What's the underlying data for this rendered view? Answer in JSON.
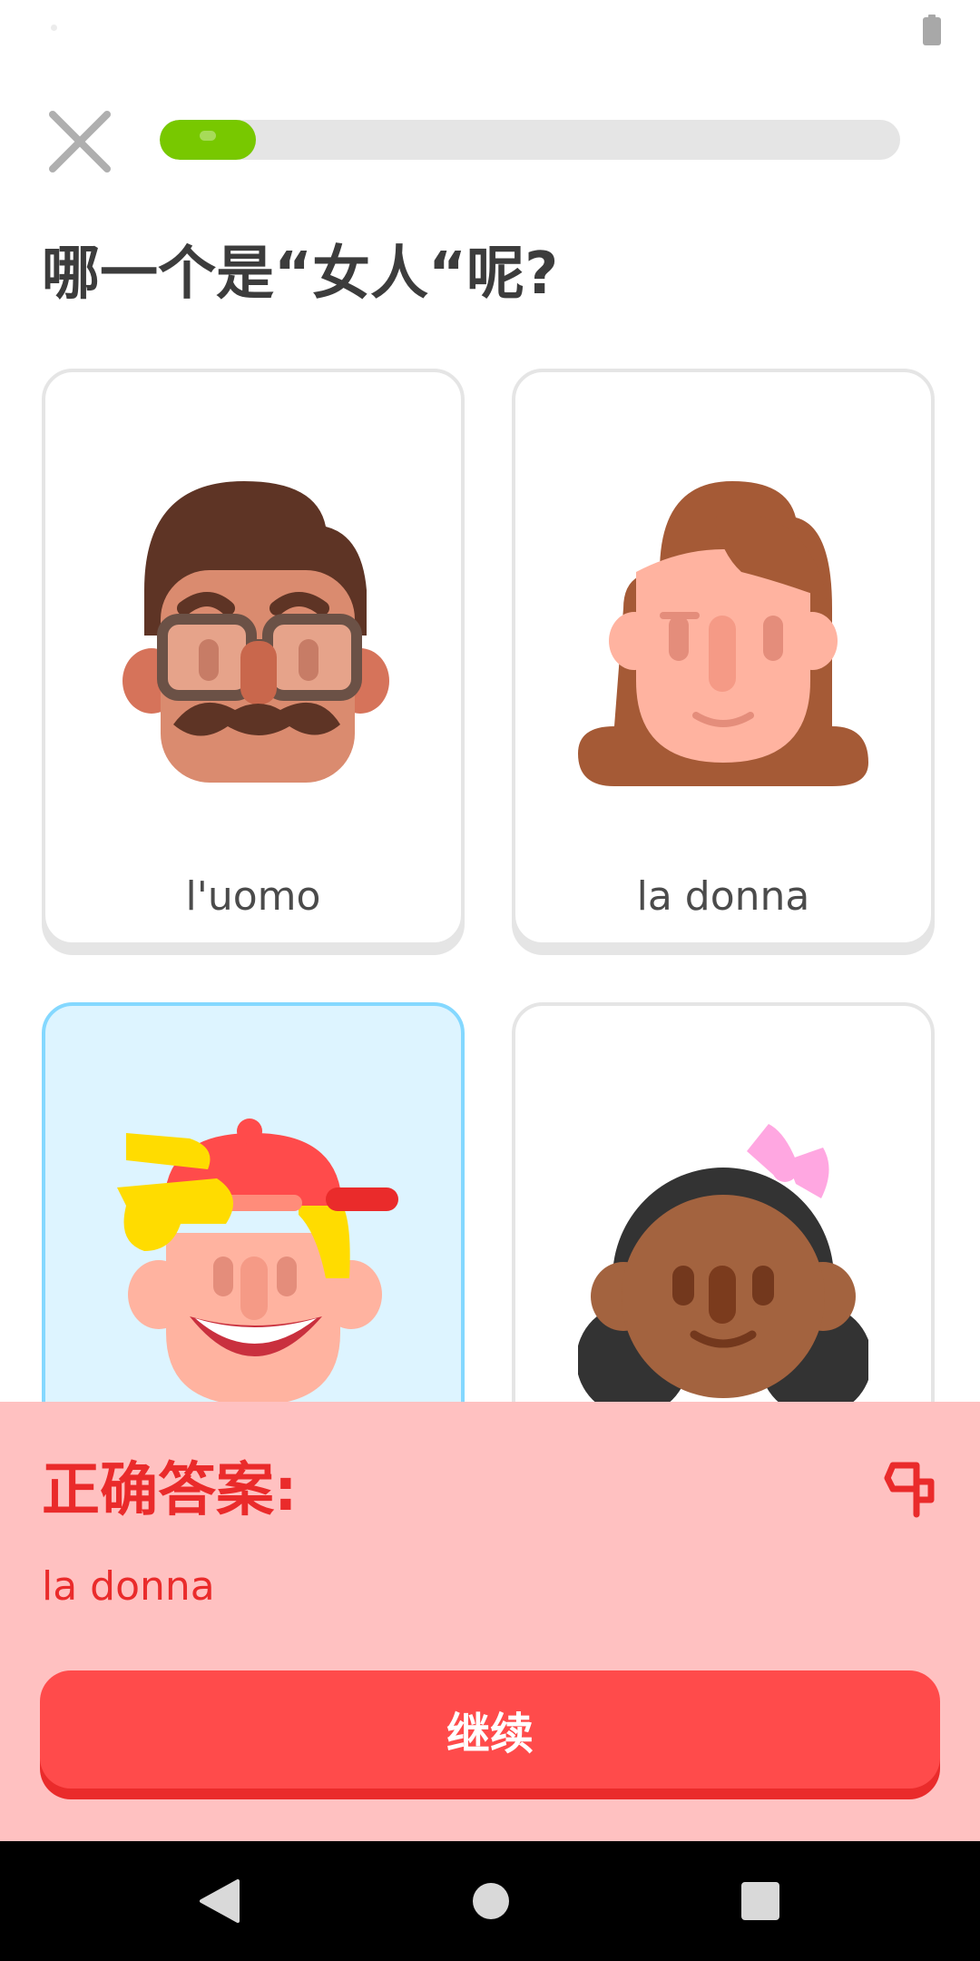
{
  "lesson": {
    "progress_fraction": 0.13,
    "progress_color": "#78c800",
    "question": "哪一个是“女人“呢?"
  },
  "options": [
    {
      "label": "l'uomo",
      "icon": "man-with-glasses-mustache-icon",
      "selected": false
    },
    {
      "label": "la donna",
      "icon": "woman-icon",
      "selected": false
    },
    {
      "label": "",
      "icon": "boy-with-cap-icon",
      "selected": true
    },
    {
      "label": "",
      "icon": "girl-with-bow-icon",
      "selected": false
    }
  ],
  "feedback": {
    "title": "正确答案:",
    "answer": "la donna",
    "continue_label": "继续",
    "report_icon": "flag-icon",
    "background_color": "#ffc1c1",
    "accent_color": "#ea2b2b"
  },
  "colors": {
    "selected_card_bg": "#ddf4ff",
    "selected_card_border": "#84d8ff",
    "button": "#ff4b4b"
  }
}
